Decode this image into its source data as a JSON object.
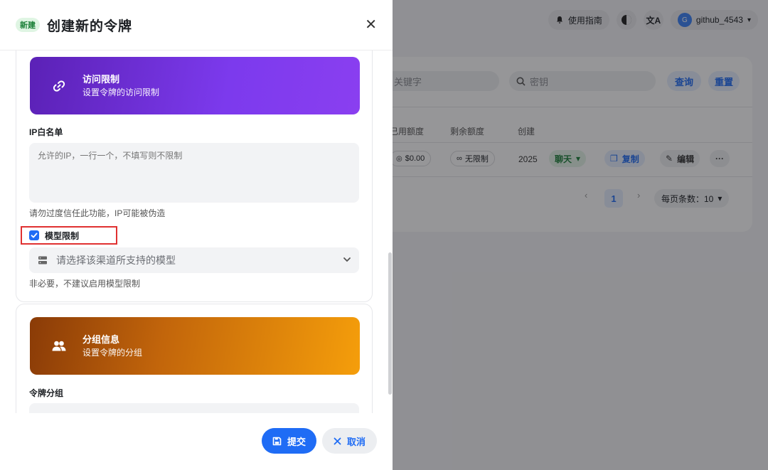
{
  "background": {
    "topbar": {
      "guide_label": "使用指南",
      "user_initial": "G",
      "username": "github_4543"
    },
    "search": {
      "keyword_placeholder": "关键字",
      "key_placeholder": "密钥",
      "query_label": "查询",
      "reset_label": "重置"
    },
    "table": {
      "columns": [
        "已用额度",
        "剩余额度",
        "创建"
      ],
      "row": {
        "used": "$0.00",
        "remaining": "无限制",
        "created": "2025",
        "chat_label": "聊天",
        "copy_label": "复制",
        "edit_label": "编辑",
        "more_label": "···"
      }
    },
    "pagination": {
      "current_page": "1",
      "page_size_label": "每页条数：10"
    }
  },
  "drawer": {
    "badge": "新建",
    "title": "创建新的令牌",
    "access_section": {
      "banner_title": "访问限制",
      "banner_subtitle": "设置令牌的访问限制",
      "ip_label": "IP白名单",
      "ip_placeholder": "允许的IP，一行一个，不填写则不限制",
      "ip_hint": "请勿过度信任此功能，IP可能被伪造",
      "model_limit_label": "模型限制",
      "model_limit_checked": true,
      "model_select_placeholder": "请选择该渠道所支持的模型",
      "model_hint": "非必要，不建议启用模型限制"
    },
    "group_section": {
      "banner_title": "分组信息",
      "banner_subtitle": "设置令牌的分组",
      "group_label": "令牌分组"
    },
    "footer": {
      "submit_label": "提交",
      "cancel_label": "取消"
    }
  },
  "colors": {
    "primary": "#1f6cf5",
    "highlight_border": "#e03131",
    "access_banner": "#7c3aed",
    "group_banner": "#f59e0b"
  }
}
